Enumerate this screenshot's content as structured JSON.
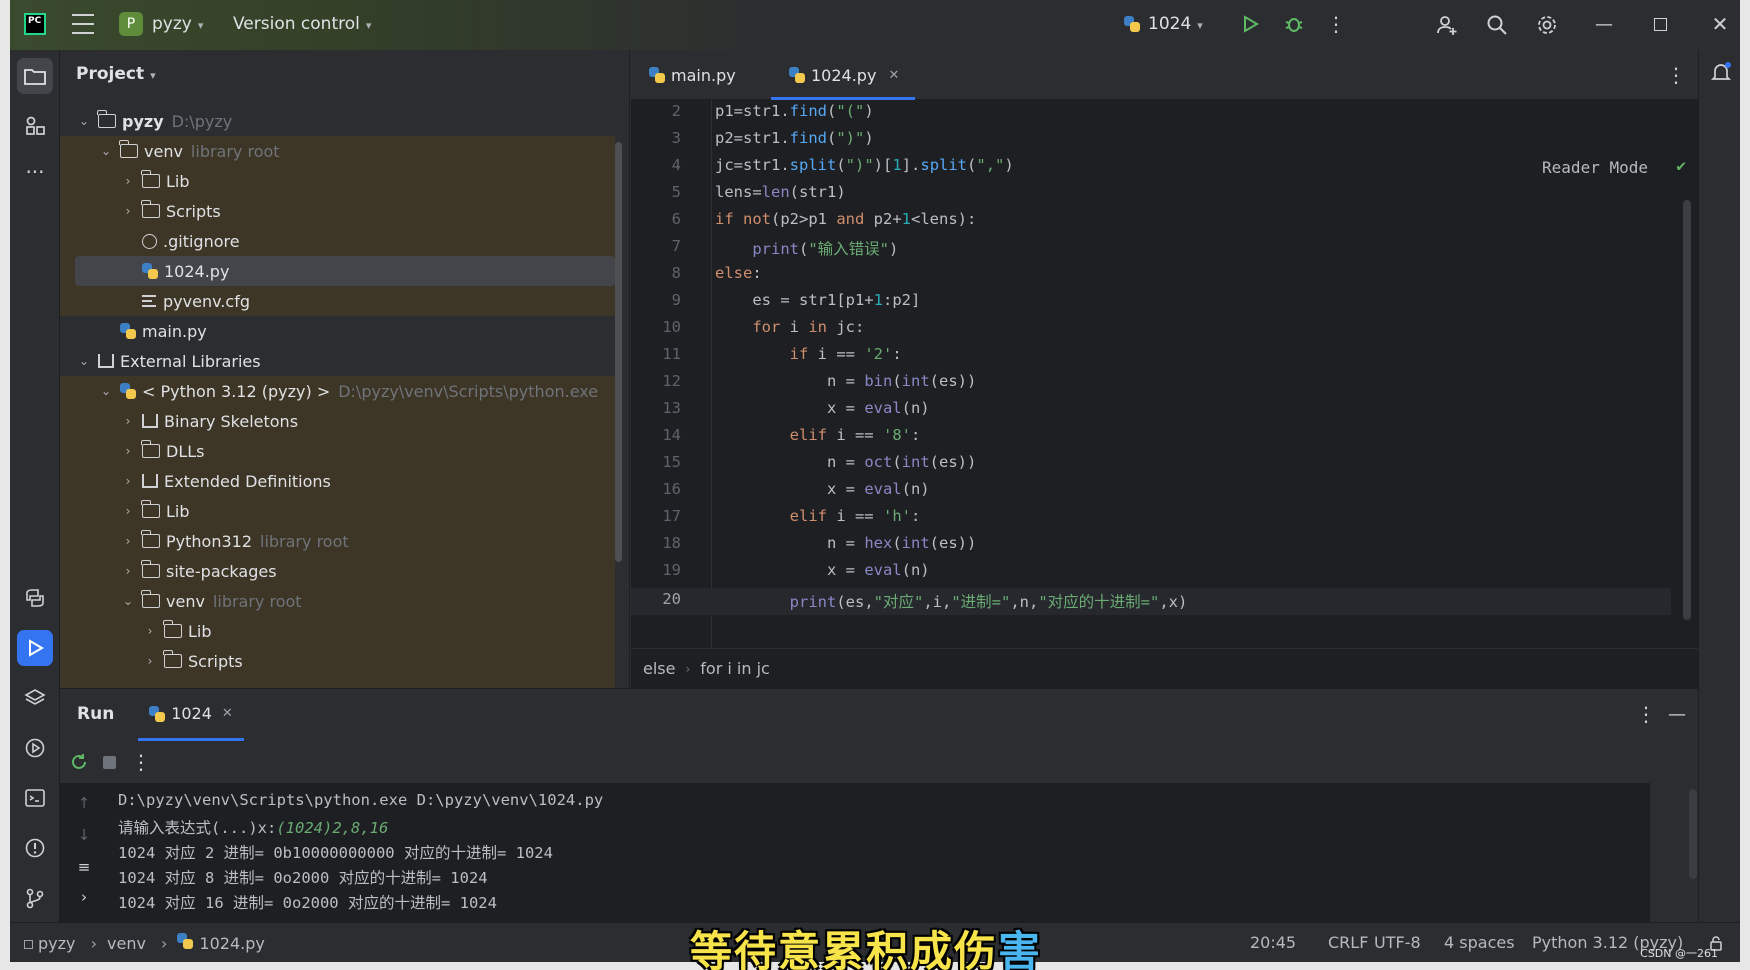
{
  "titlebar": {
    "app_logo": "PC",
    "project_badge": "P",
    "project_name": "pyzy",
    "vcs": "Version control",
    "run_config": "1024"
  },
  "project_panel": {
    "title": "Project",
    "tree": [
      {
        "label": "pyzy",
        "hint": "D:\\pyzy"
      },
      {
        "label": "venv",
        "hint": "library root"
      },
      {
        "label": "Lib"
      },
      {
        "label": "Scripts"
      },
      {
        "label": ".gitignore"
      },
      {
        "label": "1024.py"
      },
      {
        "label": "pyvenv.cfg"
      },
      {
        "label": "main.py"
      },
      {
        "label": "External Libraries"
      },
      {
        "label": "< Python 3.12 (pyzy) >",
        "hint": "D:\\pyzy\\venv\\Scripts\\python.exe"
      },
      {
        "label": "Binary Skeletons"
      },
      {
        "label": "DLLs"
      },
      {
        "label": "Extended Definitions"
      },
      {
        "label": "Lib"
      },
      {
        "label": "Python312",
        "hint": "library root"
      },
      {
        "label": "site-packages"
      },
      {
        "label": "venv",
        "hint": "library root"
      },
      {
        "label": "Lib"
      },
      {
        "label": "Scripts"
      }
    ]
  },
  "editor": {
    "tabs": [
      {
        "label": "main.py"
      },
      {
        "label": "1024.py"
      }
    ],
    "reader_mode": "Reader Mode",
    "line_numbers": [
      "2",
      "3",
      "4",
      "5",
      "6",
      "7",
      "8",
      "9",
      "10",
      "11",
      "12",
      "13",
      "14",
      "15",
      "16",
      "17",
      "18",
      "19",
      "20"
    ],
    "breadcrumb": [
      "else",
      "for i in jc"
    ]
  },
  "run_panel": {
    "title": "Run",
    "tab": "1024",
    "output": [
      "D:\\pyzy\\venv\\Scripts\\python.exe D:\\pyzy\\venv\\1024.py",
      "请输入表达式(...)x:",
      "(1024)2,8,16",
      "1024 对应 2 进制= 0b10000000000 对应的十进制= 1024",
      "1024 对应 8 进制= 0o2000 对应的十进制= 1024",
      "1024 对应 16 进制= 0o2000 对应的十进制= 1024"
    ]
  },
  "statusbar": {
    "path": [
      "pyzy",
      "venv",
      "1024.py"
    ],
    "position": "20:45",
    "line_sep": "CRLF",
    "encoding": "UTF-8",
    "indent": "4 spaces",
    "interpreter": "Python 3.12 (pyzy)"
  },
  "overlay": {
    "subtitle_main": "等待意累积成伤",
    "subtitle_highlight": "害",
    "watermark": "CSDN @一261"
  },
  "colors": {
    "accent": "#3574f0",
    "keyword": "#cf8e6d",
    "string": "#6aab73",
    "function": "#56a8f5"
  }
}
